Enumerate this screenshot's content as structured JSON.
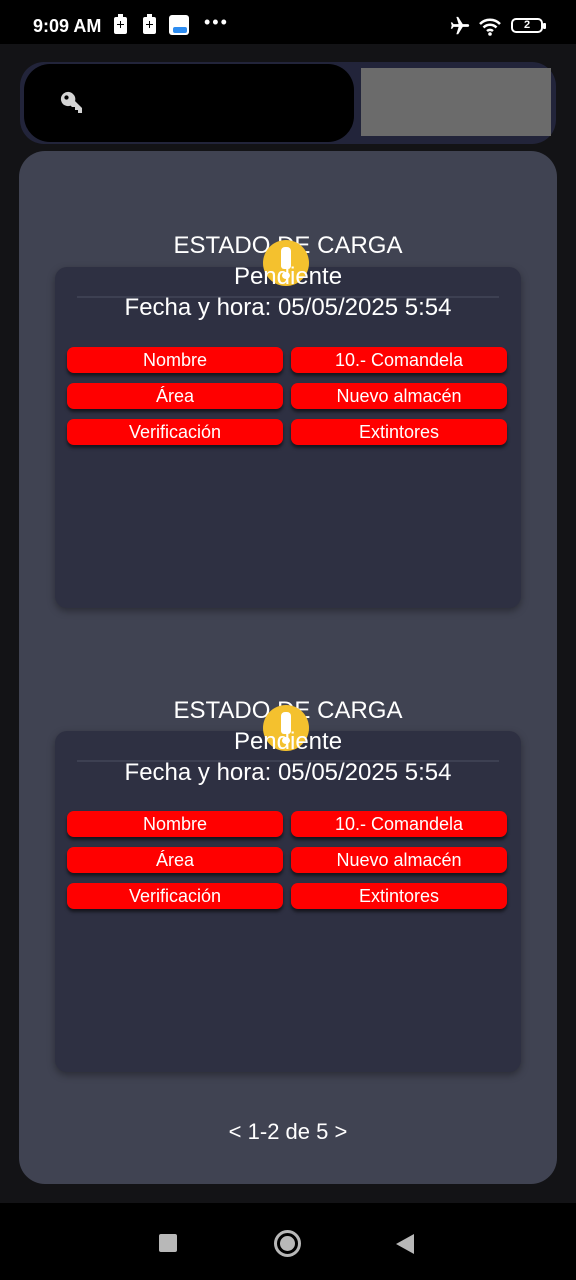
{
  "status_bar": {
    "time": "9:09 AM",
    "more": "•••",
    "battery_level": "2",
    "icons": [
      "battery-saver-icon",
      "battery-saver-icon",
      "app-notification-icon",
      "airplane-mode-icon",
      "wifi-icon",
      "battery-icon"
    ]
  },
  "header": {
    "search_icon": "key-icon",
    "search_value": "",
    "image_placeholder_color": "#6b6b6b"
  },
  "cards": [
    {
      "title": "ESTADO DE CARGA",
      "status": "Pendiente",
      "datetime": "Fecha y hora: 05/05/2025 5:54",
      "fields": [
        {
          "label": "Nombre",
          "value": "10.- Comandela"
        },
        {
          "label": "Área",
          "value": "Nuevo almacén"
        },
        {
          "label": "Verificación",
          "value": "Extintores"
        }
      ],
      "badge_icon": "warning-icon"
    },
    {
      "title": "ESTADO DE CARGA",
      "status": "Pendiente",
      "datetime": "Fecha y hora: 05/05/2025 5:54",
      "fields": [
        {
          "label": "Nombre",
          "value": "10.- Comandela"
        },
        {
          "label": "Área",
          "value": "Nuevo almacén"
        },
        {
          "label": "Verificación",
          "value": "Extintores"
        }
      ],
      "badge_icon": "warning-icon"
    }
  ],
  "pagination": {
    "text": "< 1-2 de 5 >"
  },
  "colors": {
    "chip_red": "#ff0000",
    "badge_yellow": "#f4c12e",
    "panel": "#404352",
    "card": "#2e3042"
  },
  "nav_bar": {
    "icons": [
      "recents-icon",
      "home-icon",
      "back-icon"
    ]
  }
}
